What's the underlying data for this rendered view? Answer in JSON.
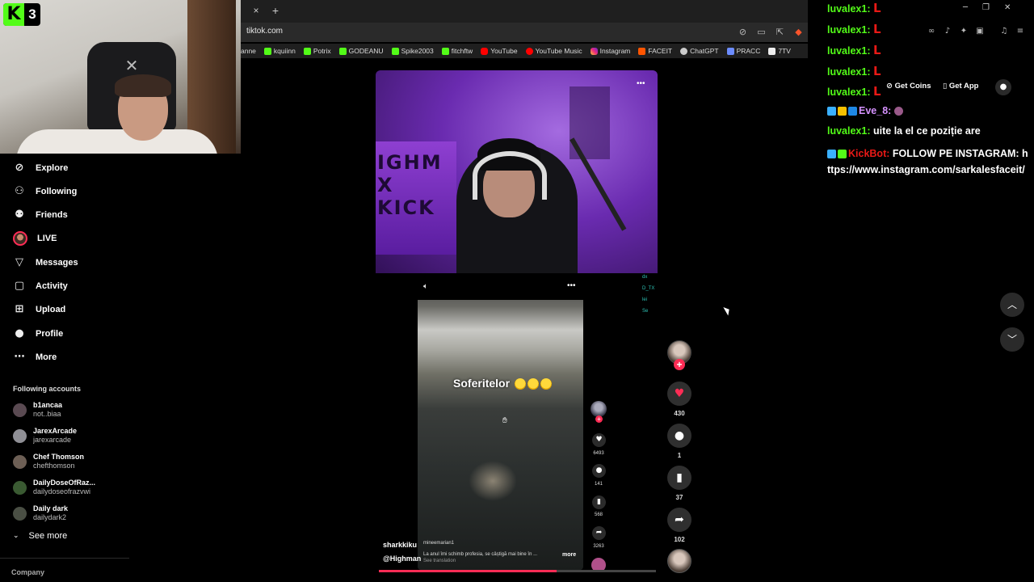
{
  "stream_overlay": {
    "platform_badge": "3",
    "kick_letter": "K"
  },
  "browser": {
    "url": "tiktok.com",
    "tab_close": "×",
    "new_tab": "+",
    "bookmarks": [
      {
        "label": "anne",
        "icon": "plain"
      },
      {
        "label": "kquiinn",
        "icon": "kick"
      },
      {
        "label": "Potrix",
        "icon": "kick"
      },
      {
        "label": "GODEANU",
        "icon": "kick"
      },
      {
        "label": "Spike2003",
        "icon": "kick"
      },
      {
        "label": "fitchftw",
        "icon": "kick"
      },
      {
        "label": "YouTube",
        "icon": "yt"
      },
      {
        "label": "YouTube Music",
        "icon": "ytm"
      },
      {
        "label": "Instagram",
        "icon": "ig"
      },
      {
        "label": "FACEIT",
        "icon": "faceit"
      },
      {
        "label": "ChatGPT",
        "icon": "gpt"
      },
      {
        "label": "PRACC",
        "icon": "pracc"
      },
      {
        "label": "7TV",
        "icon": "7tv"
      }
    ]
  },
  "sidebar": {
    "nav": [
      {
        "label": "Explore",
        "icon": "compass-icon"
      },
      {
        "label": "Following",
        "icon": "following-icon"
      },
      {
        "label": "Friends",
        "icon": "friends-icon"
      },
      {
        "label": "LIVE",
        "icon": "live-avatar"
      },
      {
        "label": "Messages",
        "icon": "messages-icon"
      },
      {
        "label": "Activity",
        "icon": "activity-icon"
      },
      {
        "label": "Upload",
        "icon": "upload-icon"
      },
      {
        "label": "Profile",
        "icon": "profile-icon"
      },
      {
        "label": "More",
        "icon": "more-icon"
      }
    ],
    "following_header": "Following accounts",
    "accounts": [
      {
        "name": "b1ancaa",
        "user": "not..biaa",
        "color": "#5a4a52"
      },
      {
        "name": "JarexArcade",
        "user": "jarexarcade",
        "color": "#8f8f95"
      },
      {
        "name": "Chef Thomson",
        "user": "chefthomson",
        "color": "#6d5f55"
      },
      {
        "name": "DailyDoseOfRaz...",
        "user": "dailydoseofrazvwi",
        "color": "#3a5a32"
      },
      {
        "name": "Daily dark",
        "user": "dailydark2",
        "color": "#4a4f44"
      }
    ],
    "see_more": "See more",
    "company": "Company"
  },
  "video": {
    "overlay_text": "Soferitelor",
    "inner_username": "sharkkiku",
    "inner_handle": "@Highman",
    "inner_user2": "mineemarian1",
    "inner_caption": "La anul îmi schimb profesia, se câștigă mai bine în ...",
    "inner_more": "more",
    "inner_translate": "See translation",
    "inner_counts": [
      "6493",
      "141",
      "568",
      "3263"
    ],
    "side_chat": [
      "dx",
      "D_TX",
      "lei",
      "Se"
    ],
    "progress": 0.64
  },
  "actions": {
    "likes": "430",
    "comments": "1",
    "bookmarks": "37",
    "shares": "102"
  },
  "header_buttons": {
    "get_coins": "Get Coins",
    "get_app": "Get App"
  },
  "chat": {
    "repeat_user": "luvalex1:",
    "repeat_msg": "L",
    "eve_user": "Eve_8:",
    "luvalex_msg": "uite la el ce poziție are",
    "kickbot_user": "KickBot:",
    "kickbot_msg": "FOLLOW PE INSTAGRAM: https://www.instagram.com/sarkalesfaceit/"
  },
  "colors": {
    "accent": "#fe2c55",
    "kick_green": "#53fc18",
    "chat_name": "#53fc18"
  }
}
